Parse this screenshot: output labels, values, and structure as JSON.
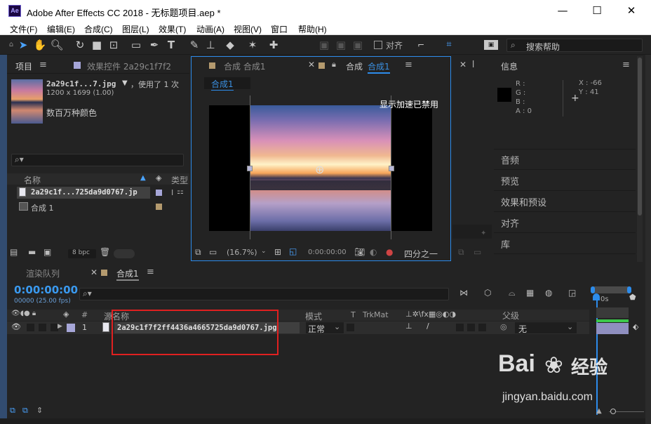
{
  "window": {
    "app_icon": "Ae",
    "title": "Adobe After Effects CC 2018 - 无标题项目.aep *",
    "minimize": "—",
    "maximize": "☐",
    "close": "✕"
  },
  "menu": [
    "文件(F)",
    "编辑(E)",
    "合成(C)",
    "图层(L)",
    "效果(T)",
    "动画(A)",
    "视图(V)",
    "窗口",
    "帮助(H)"
  ],
  "toolbar": {
    "snap_label": "对齐",
    "help_search_placeholder": "搜索帮助"
  },
  "project_panel": {
    "tab": "项目",
    "tab2": "效果控件 2a29c1f7f2",
    "thumb_name": "2a29c1f...7.jpg",
    "thumb_used": "，使用了 1 次",
    "thumb_size": "1200 x 1699 (1.00)",
    "thumb_color": "数百万种颜色",
    "col_name": "名称",
    "col_type": "类型",
    "items": [
      {
        "name": "2a29c1f...725da9d0767.jp",
        "kind": "footage"
      },
      {
        "name": "合成 1",
        "kind": "comp"
      }
    ],
    "bpc": "8 bpc"
  },
  "comp_panel": {
    "tab_inactive": "合成 合成1",
    "tab_active_prefix": "合成",
    "tab_active_name": "合成1",
    "breadcrumb": "合成1",
    "gpu_notice": "显示加速已禁用",
    "zoom": "(16.7%)",
    "timecode": "0:00:00:00",
    "resolution": "四分之一"
  },
  "info_panel": {
    "title": "信息",
    "r": "R :",
    "g": "G :",
    "b": "B :",
    "a": "A :  0",
    "x": "X : -66",
    "y": "Y : 41"
  },
  "right_panels": [
    "音频",
    "预览",
    "效果和预设",
    "对齐",
    "库"
  ],
  "timeline": {
    "tab_render": "渲染队列",
    "tab_comp": "合成1",
    "timecode": "0:00:00:00",
    "fps": "00000 (25.00 fps)",
    "col_num": "#",
    "col_name": "源名称",
    "col_mode": "模式",
    "col_t": "T",
    "col_trkmat": "TrkMat",
    "col_parent": "父级",
    "layer": {
      "num": "1",
      "name": "2a29c1f7f2ff4436a4665725da9d0767.jpg",
      "mode": "正常",
      "parent": "无"
    },
    "ruler_start": "0s"
  },
  "watermark": {
    "brand": "Bai",
    "brand_cn": "经验",
    "url": "jingyan.baidu.com"
  },
  "colors": {
    "accent_blue": "#2d8ceb",
    "highlight_red": "#e02020",
    "label_lavender": "#a6a6d8",
    "label_tan": "#b49a6e"
  }
}
